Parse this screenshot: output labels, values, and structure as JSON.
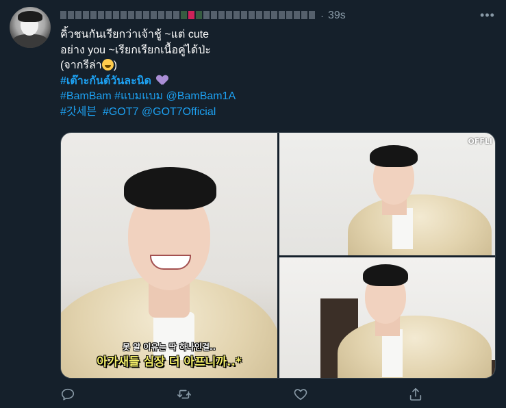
{
  "tweet": {
    "display_name_obscured": "",
    "time": "39s",
    "separator": "·",
    "more_label": "•••",
    "text": {
      "line1": "คิ้วชนกันเรียกว่าเจ้าชู้ ~แต่ cute",
      "line2": "อย่าง you ~เรียกเรียกเนื้อคู่ได้ป่ะ",
      "line3a": "(จากรีล่า",
      "line3b": ")",
      "line4_hashtag": "#เต๊าะกันต์วันละนิด",
      "line5_hashtag1": "#BamBam",
      "line5_hashtag2": "#แบมแบม",
      "line5_mention": "@BamBam1A",
      "line6_hashtag1": "#갓세븐",
      "line6_hashtag2": "#GOT7",
      "line6_mention": "@GOT7Official"
    },
    "media": {
      "subtitle_small": "못 알 이유는 딱 하나인걸..",
      "subtitle_big": "아가새들 심장 더 아프니까..*",
      "watermark": "OFFLI"
    },
    "icons": {
      "reply": "reply-icon",
      "retweet": "retweet-icon",
      "like": "heart-icon",
      "share": "share-icon",
      "heart_emoji": "purple-heart-icon",
      "laugh_emoji": "laughing-tears-icon"
    },
    "colors": {
      "background": "#15202b",
      "link": "#1da1f2",
      "muted": "#8899a6",
      "subtitle_yellow": "#f5f06a"
    }
  }
}
